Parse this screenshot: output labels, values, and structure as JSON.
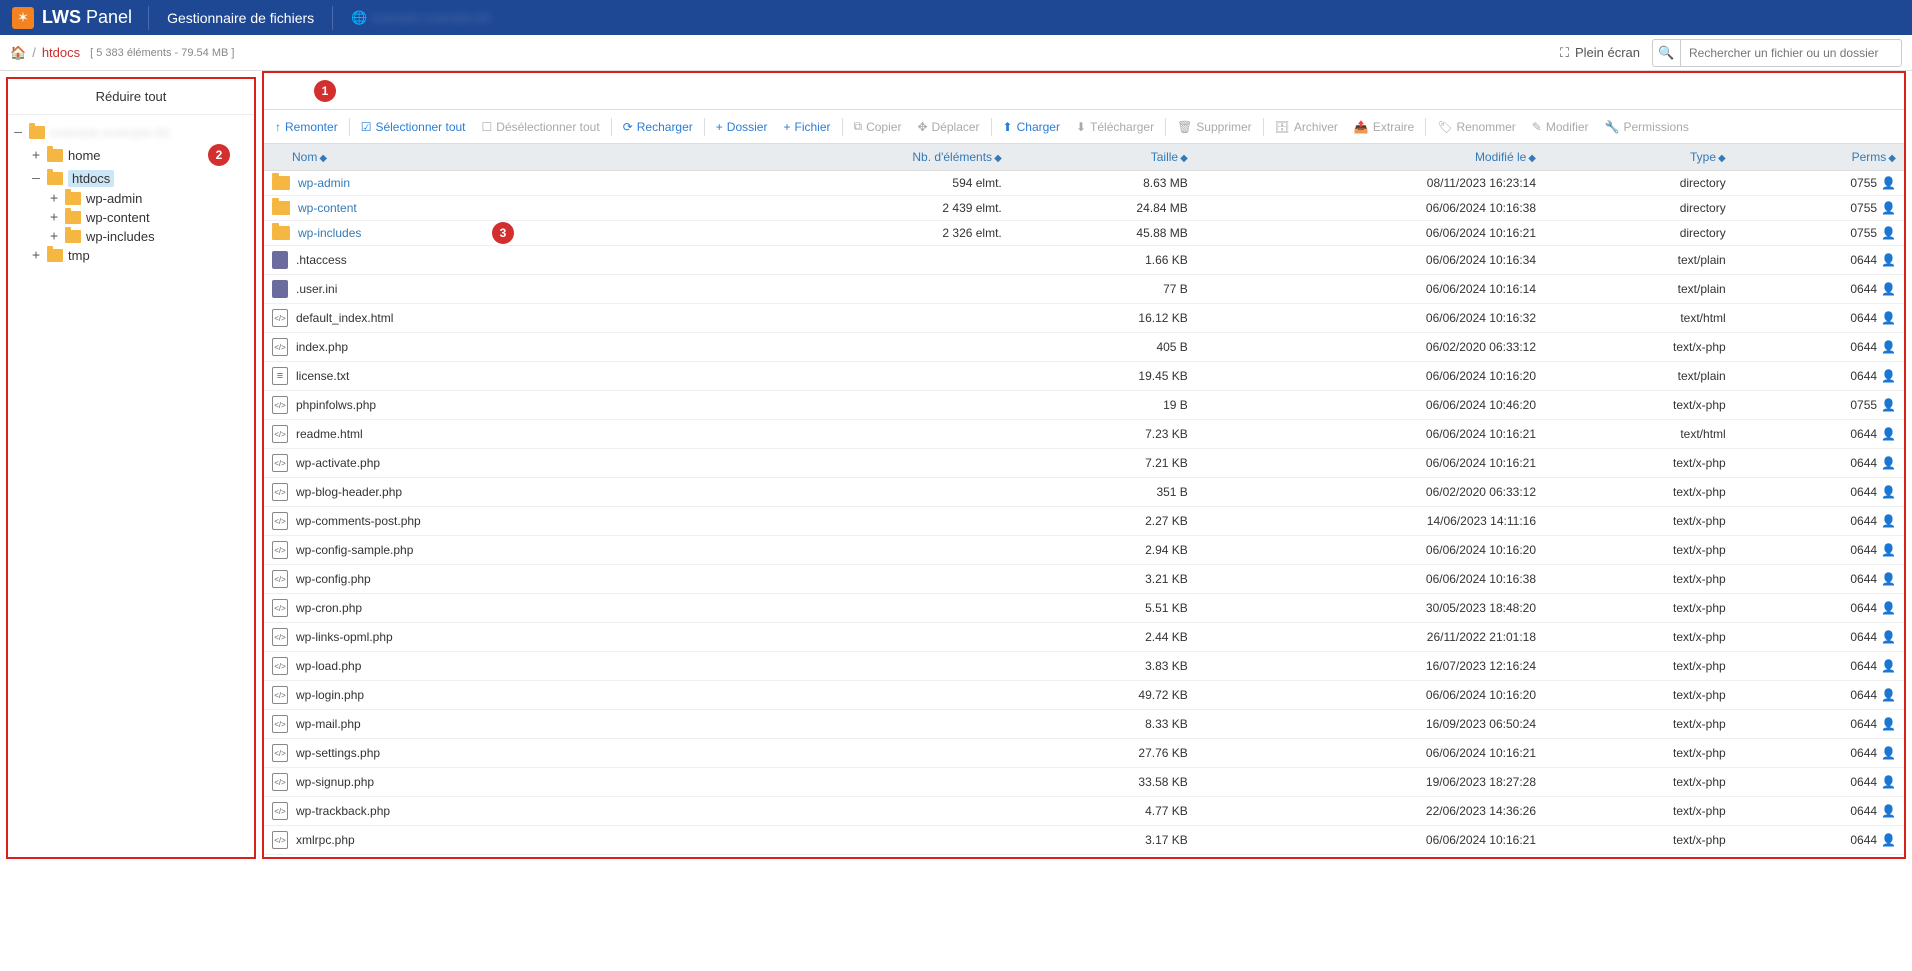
{
  "navbar": {
    "logo_text": "LWS",
    "logo_sub": "Panel",
    "title": "Gestionnaire de fichiers"
  },
  "breadcrumb": {
    "home_tooltip": "Accueil",
    "current": "htdocs",
    "stats": "[ 5 383 éléments - 79.54 MB ]"
  },
  "topright": {
    "fullscreen": "Plein écran",
    "search_placeholder": "Rechercher un fichier ou un dossier"
  },
  "tree": {
    "collapse_all": "Réduire tout",
    "root_blur": "         ",
    "nodes": {
      "home": "home",
      "htdocs": "htdocs",
      "wp_admin": "wp-admin",
      "wp_content": "wp-content",
      "wp_includes": "wp-includes",
      "tmp": "tmp"
    }
  },
  "toolbar": {
    "up": "Remonter",
    "select_all": "Sélectionner tout",
    "deselect_all": "Désélectionner tout",
    "reload": "Recharger",
    "new_folder": "Dossier",
    "new_file": "Fichier",
    "copy": "Copier",
    "move": "Déplacer",
    "upload": "Charger",
    "download": "Télécharger",
    "delete": "Supprimer",
    "archive": "Archiver",
    "extract": "Extraire",
    "rename": "Renommer",
    "edit": "Modifier",
    "permissions": "Permissions"
  },
  "columns": {
    "name": "Nom",
    "count": "Nb. d'éléments",
    "size": "Taille",
    "modified": "Modifié le",
    "type": "Type",
    "perms": "Perms"
  },
  "annotations": {
    "b1": "1",
    "b2": "2",
    "b3": "3"
  },
  "rows": [
    {
      "icon": "folder",
      "name": "wp-admin",
      "link": true,
      "count": "594 elmt.",
      "size": "8.63 MB",
      "modified": "08/11/2023 16:23:14",
      "type": "directory",
      "perms": "0755"
    },
    {
      "icon": "folder",
      "name": "wp-content",
      "link": true,
      "count": "2 439 elmt.",
      "size": "24.84 MB",
      "modified": "06/06/2024 10:16:38",
      "type": "directory",
      "perms": "0755"
    },
    {
      "icon": "folder",
      "name": "wp-includes",
      "link": true,
      "count": "2 326 elmt.",
      "size": "45.88 MB",
      "modified": "06/06/2024 10:16:21",
      "type": "directory",
      "perms": "0755",
      "badge": "3"
    },
    {
      "icon": "system",
      "name": ".htaccess",
      "count": "",
      "size": "1.66 KB",
      "modified": "06/06/2024 10:16:34",
      "type": "text/plain",
      "perms": "0644"
    },
    {
      "icon": "system",
      "name": ".user.ini",
      "count": "",
      "size": "77 B",
      "modified": "06/06/2024 10:16:14",
      "type": "text/plain",
      "perms": "0644"
    },
    {
      "icon": "code",
      "name": "default_index.html",
      "count": "",
      "size": "16.12 KB",
      "modified": "06/06/2024 10:16:32",
      "type": "text/html",
      "perms": "0644"
    },
    {
      "icon": "code",
      "name": "index.php",
      "count": "",
      "size": "405 B",
      "modified": "06/02/2020 06:33:12",
      "type": "text/x-php",
      "perms": "0644"
    },
    {
      "icon": "text",
      "name": "license.txt",
      "count": "",
      "size": "19.45 KB",
      "modified": "06/06/2024 10:16:20",
      "type": "text/plain",
      "perms": "0644"
    },
    {
      "icon": "code",
      "name": "phpinfolws.php",
      "count": "",
      "size": "19 B",
      "modified": "06/06/2024 10:46:20",
      "type": "text/x-php",
      "perms": "0755"
    },
    {
      "icon": "code",
      "name": "readme.html",
      "count": "",
      "size": "7.23 KB",
      "modified": "06/06/2024 10:16:21",
      "type": "text/html",
      "perms": "0644"
    },
    {
      "icon": "code",
      "name": "wp-activate.php",
      "count": "",
      "size": "7.21 KB",
      "modified": "06/06/2024 10:16:21",
      "type": "text/x-php",
      "perms": "0644"
    },
    {
      "icon": "code",
      "name": "wp-blog-header.php",
      "count": "",
      "size": "351 B",
      "modified": "06/02/2020 06:33:12",
      "type": "text/x-php",
      "perms": "0644"
    },
    {
      "icon": "code",
      "name": "wp-comments-post.php",
      "count": "",
      "size": "2.27 KB",
      "modified": "14/06/2023 14:11:16",
      "type": "text/x-php",
      "perms": "0644"
    },
    {
      "icon": "code",
      "name": "wp-config-sample.php",
      "count": "",
      "size": "2.94 KB",
      "modified": "06/06/2024 10:16:20",
      "type": "text/x-php",
      "perms": "0644"
    },
    {
      "icon": "code",
      "name": "wp-config.php",
      "count": "",
      "size": "3.21 KB",
      "modified": "06/06/2024 10:16:38",
      "type": "text/x-php",
      "perms": "0644"
    },
    {
      "icon": "code",
      "name": "wp-cron.php",
      "count": "",
      "size": "5.51 KB",
      "modified": "30/05/2023 18:48:20",
      "type": "text/x-php",
      "perms": "0644"
    },
    {
      "icon": "code",
      "name": "wp-links-opml.php",
      "count": "",
      "size": "2.44 KB",
      "modified": "26/11/2022 21:01:18",
      "type": "text/x-php",
      "perms": "0644"
    },
    {
      "icon": "code",
      "name": "wp-load.php",
      "count": "",
      "size": "3.83 KB",
      "modified": "16/07/2023 12:16:24",
      "type": "text/x-php",
      "perms": "0644"
    },
    {
      "icon": "code",
      "name": "wp-login.php",
      "count": "",
      "size": "49.72 KB",
      "modified": "06/06/2024 10:16:20",
      "type": "text/x-php",
      "perms": "0644"
    },
    {
      "icon": "code",
      "name": "wp-mail.php",
      "count": "",
      "size": "8.33 KB",
      "modified": "16/09/2023 06:50:24",
      "type": "text/x-php",
      "perms": "0644"
    },
    {
      "icon": "code",
      "name": "wp-settings.php",
      "count": "",
      "size": "27.76 KB",
      "modified": "06/06/2024 10:16:21",
      "type": "text/x-php",
      "perms": "0644"
    },
    {
      "icon": "code",
      "name": "wp-signup.php",
      "count": "",
      "size": "33.58 KB",
      "modified": "19/06/2023 18:27:28",
      "type": "text/x-php",
      "perms": "0644"
    },
    {
      "icon": "code",
      "name": "wp-trackback.php",
      "count": "",
      "size": "4.77 KB",
      "modified": "22/06/2023 14:36:26",
      "type": "text/x-php",
      "perms": "0644"
    },
    {
      "icon": "code",
      "name": "xmlrpc.php",
      "count": "",
      "size": "3.17 KB",
      "modified": "06/06/2024 10:16:21",
      "type": "text/x-php",
      "perms": "0644"
    }
  ]
}
